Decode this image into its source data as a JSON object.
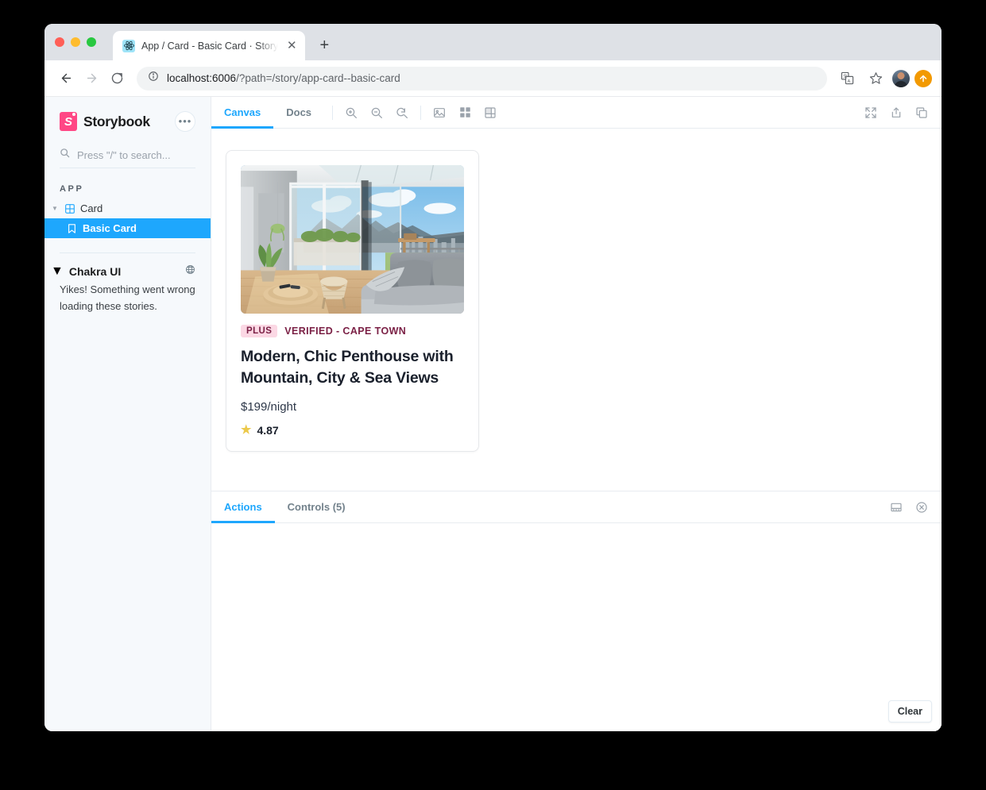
{
  "browser": {
    "tab": {
      "title": "App / Card - Basic Card · Story",
      "favicon_name": "react-logo-icon",
      "close_label": "✕"
    },
    "new_tab_label": "+",
    "nav": {
      "back_label": "←",
      "forward_label": "→",
      "reload_label": "⟳",
      "info_label": "ⓘ"
    },
    "url": {
      "host": "localhost:6006",
      "path": "/?path=/story/app-card--basic-card",
      "full": "localhost:6006/?path=/story/app-card--basic-card"
    },
    "right_icons": [
      {
        "name": "translate-icon",
        "glyph": "文"
      },
      {
        "name": "bookmark-star-icon",
        "glyph": "☆"
      },
      {
        "name": "profile-avatar",
        "glyph": ""
      },
      {
        "name": "update-icon",
        "glyph": "↑"
      }
    ]
  },
  "sidebar": {
    "brand": "Storybook",
    "logo_letter": "S",
    "menu_label": "•••",
    "search": {
      "placeholder": "Press \"/\" to search...",
      "value": "",
      "icon": "search-icon"
    },
    "section_label": "APP",
    "tree": [
      {
        "label": "Card",
        "type": "component",
        "icon": "component-grid-icon",
        "expanded": true,
        "selected": false
      },
      {
        "label": "Basic Card",
        "type": "story",
        "icon": "story-bookmark-icon",
        "selected": true
      }
    ],
    "group": {
      "label": "Chakra UI",
      "icon": "globe-icon",
      "error_message": "Yikes! Something went wrong loading these stories."
    }
  },
  "toolbar": {
    "tabs": [
      {
        "label": "Canvas",
        "active": true
      },
      {
        "label": "Docs",
        "active": false
      }
    ],
    "zoom_icons": [
      {
        "name": "zoom-in-icon",
        "title": "Zoom in"
      },
      {
        "name": "zoom-out-icon",
        "title": "Zoom out"
      },
      {
        "name": "zoom-reset-icon",
        "title": "Reset zoom"
      }
    ],
    "view_icons": [
      {
        "name": "background-image-icon",
        "title": "Change background"
      },
      {
        "name": "grid-icon",
        "title": "Apply grid"
      },
      {
        "name": "measure-icon",
        "title": "Measure"
      }
    ],
    "right_icons": [
      {
        "name": "fullscreen-icon",
        "title": "Go full screen"
      },
      {
        "name": "share-icon",
        "title": "Open canvas in new tab"
      },
      {
        "name": "copy-link-icon",
        "title": "Copy canvas link"
      }
    ]
  },
  "story": {
    "badge": "PLUS",
    "meta": "VERIFIED - CAPE TOWN",
    "title": "Modern, Chic Penthouse with Mountain, City & Sea Views",
    "price": "$199/night",
    "rating": "4.87",
    "star_icon": "star-icon",
    "image_alt": "penthouse-living-room-photo",
    "colors": {
      "badge_bg": "#fbd8e4",
      "badge_text": "#7b2146",
      "star": "#ecc94b"
    }
  },
  "addons": {
    "tabs": [
      {
        "label": "Actions",
        "active": true
      },
      {
        "label": "Controls (5)",
        "active": false
      }
    ],
    "right_icons": [
      {
        "name": "panel-position-icon",
        "title": "Change addon orientation"
      },
      {
        "name": "close-panel-icon",
        "title": "Hide addons"
      }
    ],
    "clear_label": "Clear"
  },
  "theme": {
    "accent": "#1ea7fd",
    "brand_pink": "#ff4785",
    "sidebar_bg": "#f6f9fc"
  }
}
